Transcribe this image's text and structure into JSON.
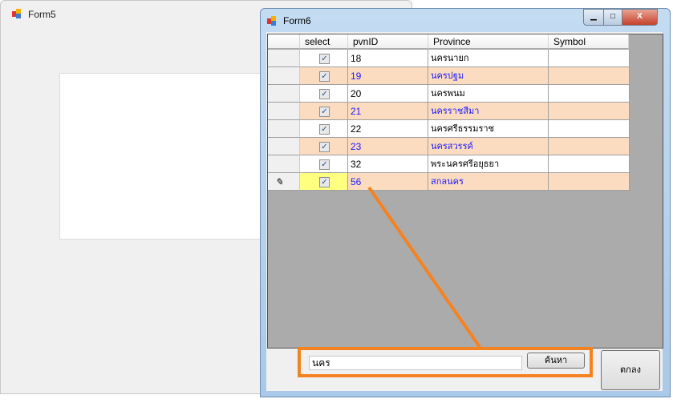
{
  "form5": {
    "title": "Form5"
  },
  "form6": {
    "title": "Form6",
    "columns": [
      "select",
      "pvnID",
      "Province",
      "Symbol"
    ],
    "rows": [
      {
        "select": true,
        "pvnID": "18",
        "province": "นครนายก",
        "symbol": ""
      },
      {
        "select": true,
        "pvnID": "19",
        "province": "นครปฐม",
        "symbol": ""
      },
      {
        "select": true,
        "pvnID": "20",
        "province": "นครพนม",
        "symbol": ""
      },
      {
        "select": true,
        "pvnID": "21",
        "province": "นครราชสีมา",
        "symbol": ""
      },
      {
        "select": true,
        "pvnID": "22",
        "province": "นครศรีธรรมราช",
        "symbol": ""
      },
      {
        "select": true,
        "pvnID": "23",
        "province": "นครสวรรค์",
        "symbol": ""
      },
      {
        "select": true,
        "pvnID": "32",
        "province": "พระนครศรีอยุธยา",
        "symbol": ""
      },
      {
        "select": true,
        "pvnID": "56",
        "province": "สกลนคร",
        "symbol": ""
      }
    ],
    "search_value": "นคร",
    "search_button": "ค้นหา",
    "ok_button": "ตกลง"
  },
  "colors": {
    "alt_row": "#fcdcc0",
    "alt_text": "#1a1aff",
    "highlight": "#f58220",
    "edit_cell": "#ffff80"
  }
}
